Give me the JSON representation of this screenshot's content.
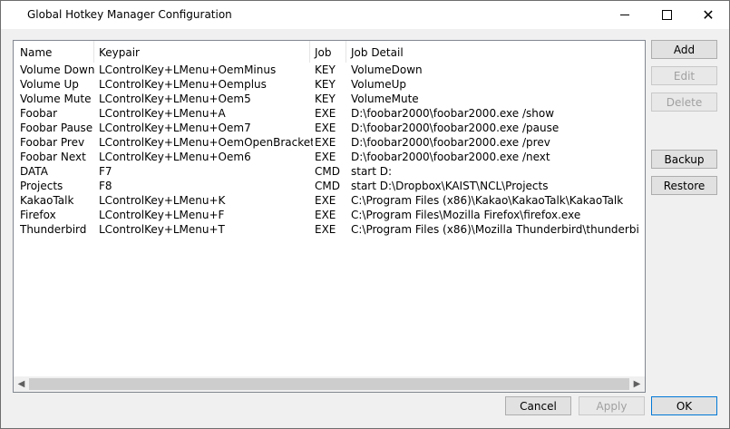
{
  "window": {
    "title": "Global Hotkey Manager Configuration"
  },
  "list": {
    "columns": [
      "Name",
      "Keypair",
      "Job",
      "Job Detail"
    ],
    "rows": [
      [
        "Volume Down",
        "LControlKey+LMenu+OemMinus",
        "KEY",
        "VolumeDown"
      ],
      [
        "Volume Up",
        "LControlKey+LMenu+Oemplus",
        "KEY",
        "VolumeUp"
      ],
      [
        "Volume Mute",
        "LControlKey+LMenu+Oem5",
        "KEY",
        "VolumeMute"
      ],
      [
        "Foobar",
        "LControlKey+LMenu+A",
        "EXE",
        "D:\\foobar2000\\foobar2000.exe /show"
      ],
      [
        "Foobar Pause",
        "LControlKey+LMenu+Oem7",
        "EXE",
        "D:\\foobar2000\\foobar2000.exe /pause"
      ],
      [
        "Foobar Prev",
        "LControlKey+LMenu+OemOpenBrackets",
        "EXE",
        "D:\\foobar2000\\foobar2000.exe /prev"
      ],
      [
        "Foobar Next",
        "LControlKey+LMenu+Oem6",
        "EXE",
        "D:\\foobar2000\\foobar2000.exe /next"
      ],
      [
        "DATA",
        "F7",
        "CMD",
        "start D:"
      ],
      [
        "Projects",
        "F8",
        "CMD",
        "start D:\\Dropbox\\KAIST\\NCL\\Projects"
      ],
      [
        "KakaoTalk",
        "LControlKey+LMenu+K",
        "EXE",
        "C:\\Program Files (x86)\\Kakao\\KakaoTalk\\KakaoTalk"
      ],
      [
        "Firefox",
        "LControlKey+LMenu+F",
        "EXE",
        "C:\\Program Files\\Mozilla Firefox\\firefox.exe"
      ],
      [
        "Thunderbird",
        "LControlKey+LMenu+T",
        "EXE",
        "C:\\Program Files (x86)\\Mozilla Thunderbird\\thunderbi"
      ]
    ]
  },
  "buttons": {
    "add": "Add",
    "edit": "Edit",
    "delete": "Delete",
    "backup": "Backup",
    "restore": "Restore",
    "cancel": "Cancel",
    "apply": "Apply",
    "ok": "OK"
  },
  "icons": {
    "minimize": "minimize-icon",
    "maximize": "maximize-icon",
    "close": "close-icon",
    "scroll_left": "scroll-left-icon",
    "scroll_right": "scroll-right-icon"
  },
  "colors": {
    "default_button_border": "#0078d7",
    "disabled_text": "#a0a0a0"
  }
}
